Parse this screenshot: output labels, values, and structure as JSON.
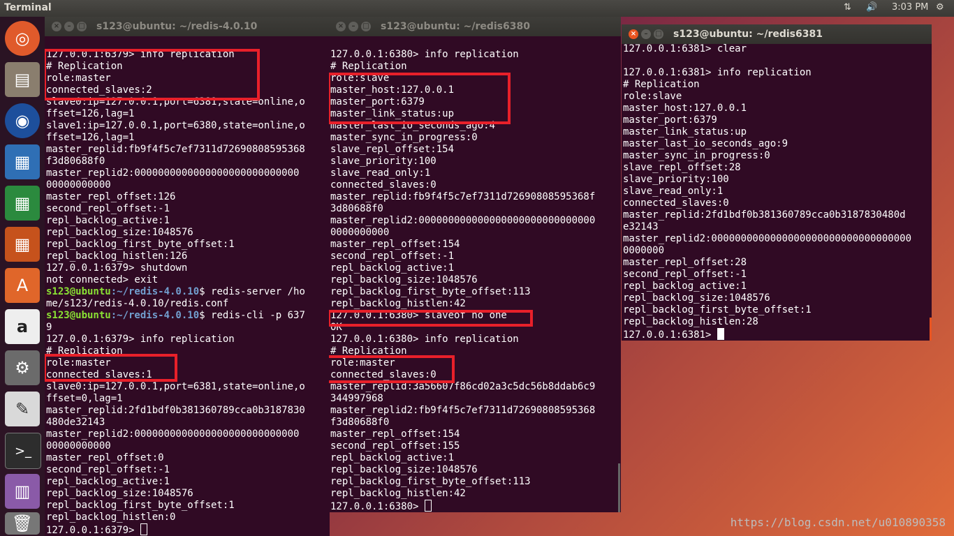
{
  "topbar": {
    "app_name": "Terminal",
    "network_icon": "network-arrows-icon",
    "volume_icon": "volume-icon",
    "time": "3:03 PM",
    "power_icon": "power-gear-icon"
  },
  "launcher": {
    "items": [
      {
        "name": "ubuntu-dash-icon"
      },
      {
        "name": "files-icon"
      },
      {
        "name": "firefox-icon"
      },
      {
        "name": "writer-icon"
      },
      {
        "name": "calc-icon"
      },
      {
        "name": "impress-icon"
      },
      {
        "name": "software-center-icon"
      },
      {
        "name": "amazon-icon"
      },
      {
        "name": "system-settings-icon"
      },
      {
        "name": "text-editor-icon"
      },
      {
        "name": "terminal-icon"
      },
      {
        "name": "workspace-switcher-icon"
      },
      {
        "name": "trash-icon"
      }
    ]
  },
  "term1": {
    "title": "s123@ubuntu: ~/redis-4.0.10",
    "lines": [
      "127.0.0.1:6379> info replication",
      "# Replication",
      "role:master",
      "connected_slaves:2",
      "slave0:ip=127.0.0.1,port=6381,state=online,o",
      "ffset=126,lag=1",
      "slave1:ip=127.0.0.1,port=6380,state=online,o",
      "ffset=126,lag=1",
      "master_replid:fb9f4f5c7ef7311d72690808595368",
      "f3d80688f0",
      "master_replid2:0000000000000000000000000000",
      "00000000000",
      "master_repl_offset:126",
      "second_repl_offset:-1",
      "repl_backlog_active:1",
      "repl_backlog_size:1048576",
      "repl_backlog_first_byte_offset:1",
      "repl_backlog_histlen:126",
      "127.0.0.1:6379> shutdown",
      "not connected> exit",
      "",
      "me/s123/redis-4.0.10/redis.conf",
      "",
      "9",
      "127.0.0.1:6379> info replication",
      "# Replication",
      "role:master",
      "connected_slaves:1",
      "slave0:ip=127.0.0.1,port=6381,state=online,o",
      "ffset=0,lag=1",
      "master_replid:2fd1bdf0b381360789cca0b3187830",
      "480de32143",
      "master_replid2:0000000000000000000000000000",
      "00000000000",
      "master_repl_offset:0",
      "second_repl_offset:-1",
      "repl_backlog_active:1",
      "repl_backlog_size:1048576",
      "repl_backlog_first_byte_offset:1",
      "repl_backlog_histlen:0",
      "127.0.0.1:6379> "
    ],
    "cmd1_user": "s123@ubuntu",
    "cmd1_path": ":~/redis-4.0.10",
    "cmd1_text": "$ redis-server /ho",
    "cmd2_user": "s123@ubuntu",
    "cmd2_path": ":~/redis-4.0.10",
    "cmd2_text": "$ redis-cli -p 637"
  },
  "term2": {
    "title": "s123@ubuntu: ~/redis6380",
    "lines": [
      "127.0.0.1:6380> info replication",
      "# Replication",
      "role:slave",
      "master_host:127.0.0.1",
      "master_port:6379",
      "master_link_status:up",
      "master_last_io_seconds_ago:4",
      "master_sync_in_progress:0",
      "slave_repl_offset:154",
      "slave_priority:100",
      "slave_read_only:1",
      "connected_slaves:0",
      "master_replid:fb9f4f5c7ef7311d72690808595368f",
      "3d80688f0",
      "master_replid2:000000000000000000000000000000",
      "0000000000",
      "master_repl_offset:154",
      "second_repl_offset:-1",
      "repl_backlog_active:1",
      "repl_backlog_size:1048576",
      "repl_backlog_first_byte_offset:113",
      "repl_backlog_histlen:42",
      "127.0.0.1:6380> slaveof no one",
      "OK",
      "127.0.0.1:6380> info replication",
      "# Replication",
      "role:master",
      "connected_slaves:0",
      "master_replid:3a56607f86cd02a3c5dc56b8ddab6c9",
      "344997968",
      "master_replid2:fb9f4f5c7ef7311d72690808595368",
      "f3d80688f0",
      "master_repl_offset:154",
      "second_repl_offset:155",
      "repl_backlog_active:1",
      "repl_backlog_size:1048576",
      "repl_backlog_first_byte_offset:113",
      "repl_backlog_histlen:42",
      "127.0.0.1:6380> "
    ]
  },
  "term3": {
    "title": "s123@ubuntu: ~/redis6381",
    "lines": [
      "127.0.0.1:6381> clear",
      "",
      "127.0.0.1:6381> info replication",
      "# Replication",
      "role:slave",
      "master_host:127.0.0.1",
      "master_port:6379",
      "master_link_status:up",
      "master_last_io_seconds_ago:9",
      "master_sync_in_progress:0",
      "slave_repl_offset:28",
      "slave_priority:100",
      "slave_read_only:1",
      "connected_slaves:0",
      "master_replid:2fd1bdf0b381360789cca0b3187830480d",
      "e32143",
      "master_replid2:0000000000000000000000000000000000",
      "0000000",
      "master_repl_offset:28",
      "second_repl_offset:-1",
      "repl_backlog_active:1",
      "repl_backlog_size:1048576",
      "repl_backlog_first_byte_offset:1",
      "repl_backlog_histlen:28",
      "127.0.0.1:6381> "
    ]
  },
  "watermark": "https://blog.csdn.net/u010890358",
  "colors": {
    "terminal_bg": "#300a24",
    "highlight": "#e8202a",
    "prompt_user": "#8ae234",
    "prompt_path": "#729fcf",
    "close_active": "#e95420"
  }
}
